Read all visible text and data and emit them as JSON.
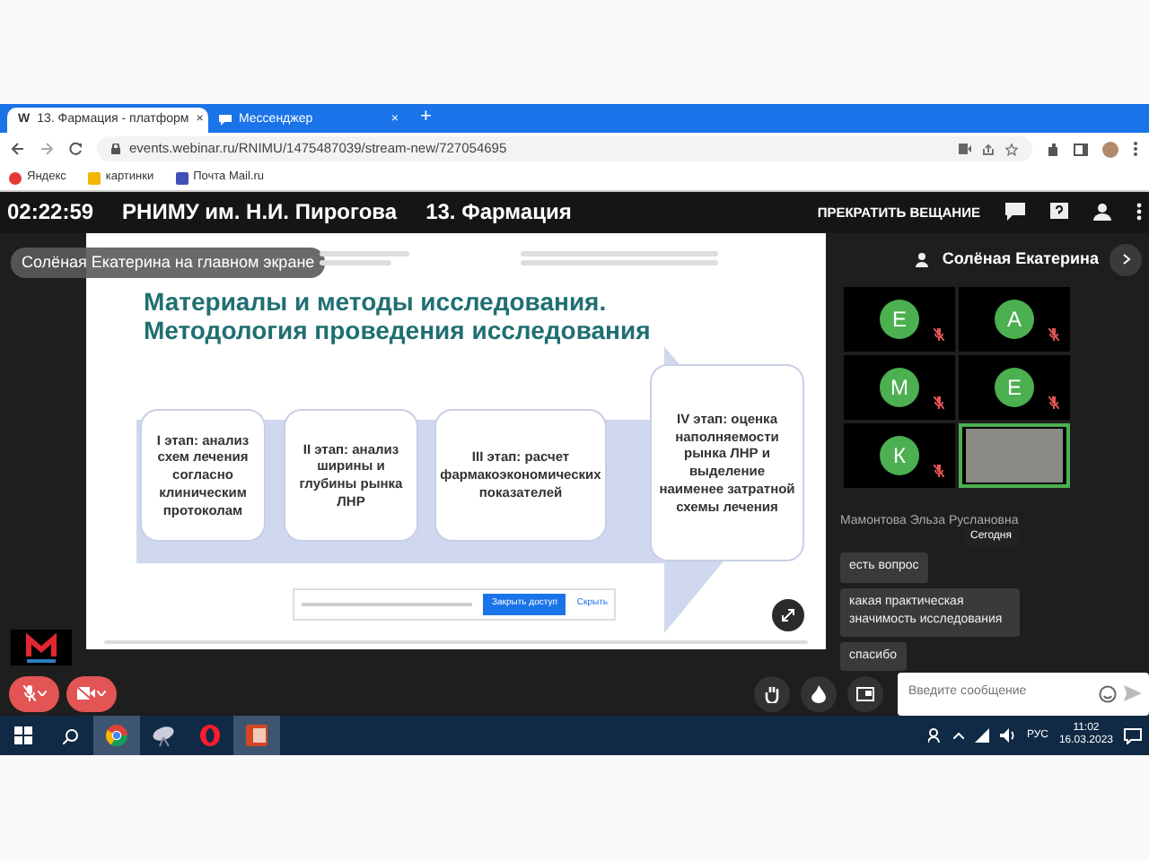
{
  "browser": {
    "tabs": [
      {
        "favicon": "W",
        "label": "13. Фармация - платформ",
        "close": "×",
        "selected": true
      },
      {
        "label": "Мессенджер",
        "close": "×",
        "selected": false
      }
    ],
    "new_tab": "+",
    "url": "events.webinar.ru/RNIMU/1475487039/stream-new/727054695",
    "bookmarks": [
      "Яндекс",
      "картинки",
      "Почта Mail.ru"
    ]
  },
  "header": {
    "timer": "02:22:59",
    "organization": "РНИМУ им. Н.И. Пирогова",
    "event": "13. Фармация",
    "stop_button": "ПРЕКРАТИТЬ ВЕЩАНИЕ"
  },
  "slide": {
    "presenter_label": "Солёная Екатерина на главном экране",
    "title_lines": [
      "Материалы и методы исследования.",
      "Методология проведения исследования"
    ],
    "stages": [
      "I этап: анализ схем лечения согласно клиническим протоколам",
      "II этап: анализ ширины и глубины рынка ЛНР",
      "III этап: расчет фармакоэкономических показателей",
      "IV этап: оценка наполняемости рынка ЛНР и выделение наименее затратной схемы лечения"
    ],
    "share_bar": {
      "stop": "Закрыть доступ",
      "hide": "Скрыть"
    }
  },
  "participants": {
    "featured": "Солёная Екатерина",
    "tiles": [
      {
        "kind": "avatar",
        "initial": "Е",
        "muted": true,
        "speaking": false
      },
      {
        "kind": "avatar",
        "initial": "А",
        "muted": true,
        "speaking": false
      },
      {
        "kind": "avatar",
        "initial": "М",
        "muted": true,
        "speaking": false
      },
      {
        "kind": "avatar",
        "initial": "Е",
        "muted": true,
        "speaking": false
      },
      {
        "kind": "avatar",
        "initial": "К",
        "muted": true,
        "speaking": false
      },
      {
        "kind": "video",
        "muted": false,
        "speaking": true
      }
    ]
  },
  "chat": {
    "sender": "Мамонтова Эльза Руслановна",
    "date_tooltip": "Сегодня",
    "messages": [
      "есть вопрос",
      "какая практическая значимость исследования",
      "спасибо"
    ],
    "placeholder": "Введите сообщение"
  },
  "controls": {
    "mic_muted": true,
    "camera_off": true
  },
  "taskbar": {
    "apps": [
      {
        "kind": "chrome",
        "selected": true
      },
      {
        "kind": "tool",
        "selected": false
      },
      {
        "kind": "opera",
        "selected": false
      },
      {
        "kind": "powerpoint",
        "selected": true
      }
    ],
    "language": "РУС",
    "time": "11:02",
    "date": "16.03.2023"
  }
}
